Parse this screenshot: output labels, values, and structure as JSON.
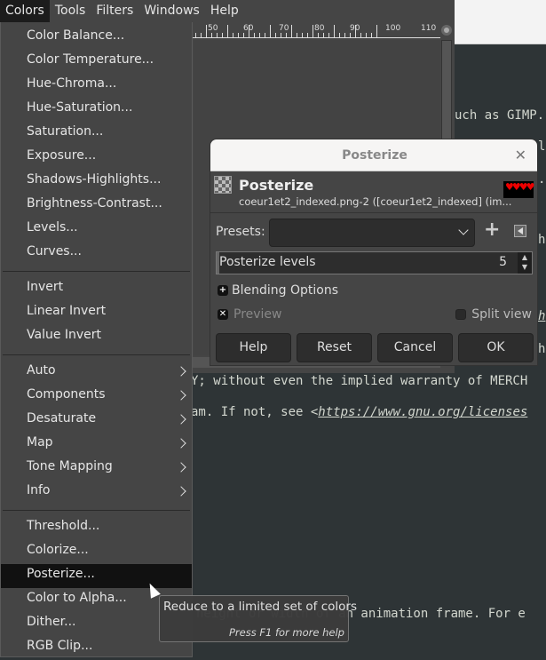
{
  "menubar": {
    "items": [
      "Colors",
      "Tools",
      "Filters",
      "Windows",
      "Help"
    ],
    "active": "Colors"
  },
  "ruler": {
    "labels": [
      "50",
      "60",
      "70",
      "80",
      "90",
      "100",
      "110"
    ]
  },
  "colors_menu": {
    "groups": [
      [
        "Color Balance...",
        "Color Temperature...",
        "Hue-Chroma...",
        "Hue-Saturation...",
        "Saturation...",
        "Exposure...",
        "Shadows-Highlights...",
        "Brightness-Contrast...",
        "Levels...",
        "Curves..."
      ],
      [
        "Invert",
        "Linear Invert",
        "Value Invert"
      ],
      [
        "Auto",
        "Components",
        "Desaturate",
        "Map",
        "Tone Mapping",
        "Info"
      ],
      [
        "Threshold...",
        "Colorize...",
        "Posterize...",
        "Color to Alpha...",
        "Dither...",
        "RGB Clip..."
      ]
    ],
    "submenu_items": [
      "Auto",
      "Components",
      "Desaturate",
      "Map",
      "Tone Mapping",
      "Info"
    ],
    "highlighted": "Posterize..."
  },
  "tooltip": {
    "text": "Reduce to a limited set of colors",
    "hint": "Press F1 for more help"
  },
  "dialog": {
    "window_title": "Posterize",
    "title": "Posterize",
    "subtitle": "coeur1et2_indexed.png-2 ([coeur1et2_indexed] (im...",
    "thumbnail": "♥♥♥♥",
    "presets_label": "Presets:",
    "presets_value": "",
    "levels_label": "Posterize levels",
    "levels_value": "5",
    "blending": "Blending Options",
    "preview": "Preview",
    "preview_checked": true,
    "split_view": "Split view",
    "split_checked": false,
    "buttons": [
      "Help",
      "Reset",
      "Cancel",
      "OK"
    ]
  },
  "editor": {
    "lines": [
      "uch as GIMP.",
      "l",
      "..",
      "h",
      "h",
      "h",
      "Y; without even the implied warranty of MERCH",
      "am. If not, see <",
      "https://www.gnu.org/licenses",
      "height or width of an animation frame. For e"
    ]
  }
}
